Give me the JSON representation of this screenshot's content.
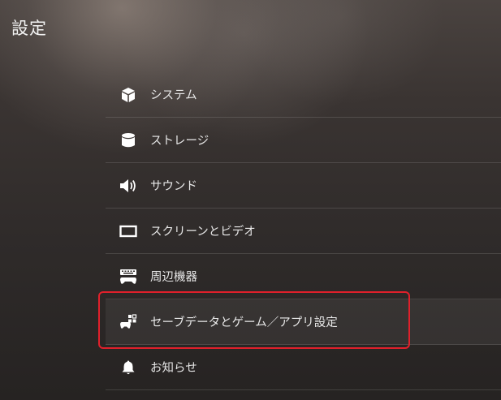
{
  "header": {
    "title": "設定"
  },
  "menu": {
    "items": [
      {
        "label": "システム",
        "icon": "cube-icon"
      },
      {
        "label": "ストレージ",
        "icon": "database-icon"
      },
      {
        "label": "サウンド",
        "icon": "speaker-icon"
      },
      {
        "label": "スクリーンとビデオ",
        "icon": "screen-icon"
      },
      {
        "label": "周辺機器",
        "icon": "controller-keyboard-icon"
      },
      {
        "label": "セーブデータとゲーム／アプリ設定",
        "icon": "gamepad-apps-icon",
        "selected": true
      },
      {
        "label": "お知らせ",
        "icon": "bell-icon"
      }
    ]
  },
  "colors": {
    "highlight": "#e0202b",
    "text": "#e8e8e8"
  }
}
